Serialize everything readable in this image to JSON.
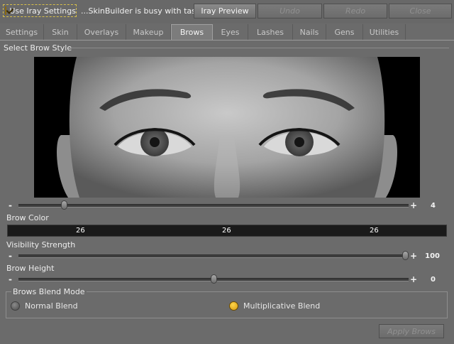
{
  "topbar": {
    "iray_checkbox_label": "Use Iray Settings",
    "iray_checked": true,
    "status_text": "...SkinBuilder is busy with task...",
    "iray_preview_label": "Iray Preview",
    "undo_label": "Undo",
    "redo_label": "Redo",
    "close_label": "Close"
  },
  "tabs": [
    {
      "label": "Settings",
      "active": false
    },
    {
      "label": "Skin",
      "active": false
    },
    {
      "label": "Overlays",
      "active": false
    },
    {
      "label": "Makeup",
      "active": false
    },
    {
      "label": "Brows",
      "active": true
    },
    {
      "label": "Eyes",
      "active": false
    },
    {
      "label": "Lashes",
      "active": false
    },
    {
      "label": "Nails",
      "active": false
    },
    {
      "label": "Gens",
      "active": false
    },
    {
      "label": "Utilities",
      "active": false
    }
  ],
  "brow_style": {
    "title": "Select Brow Style",
    "slider_value": "4",
    "slider_fraction": 0.11,
    "minus": "-",
    "plus": "+"
  },
  "brow_color": {
    "title": "Brow Color",
    "r": "26",
    "g": "26",
    "b": "26",
    "swatch": "#1a1a1a"
  },
  "visibility": {
    "title": "Visibility Strength",
    "value": "100",
    "fraction": 1.0,
    "minus": "-",
    "plus": "+"
  },
  "height": {
    "title": "Brow Height",
    "value": "0",
    "fraction": 0.5,
    "minus": "-",
    "plus": "+"
  },
  "blend": {
    "title": "Brows Blend Mode",
    "options": [
      {
        "label": "Normal Blend",
        "selected": false
      },
      {
        "label": "Multiplicative Blend",
        "selected": true
      }
    ]
  },
  "apply_label": "Apply Brows",
  "colors": {
    "accent": "#f3c52a",
    "background": "#6b6b6b"
  }
}
